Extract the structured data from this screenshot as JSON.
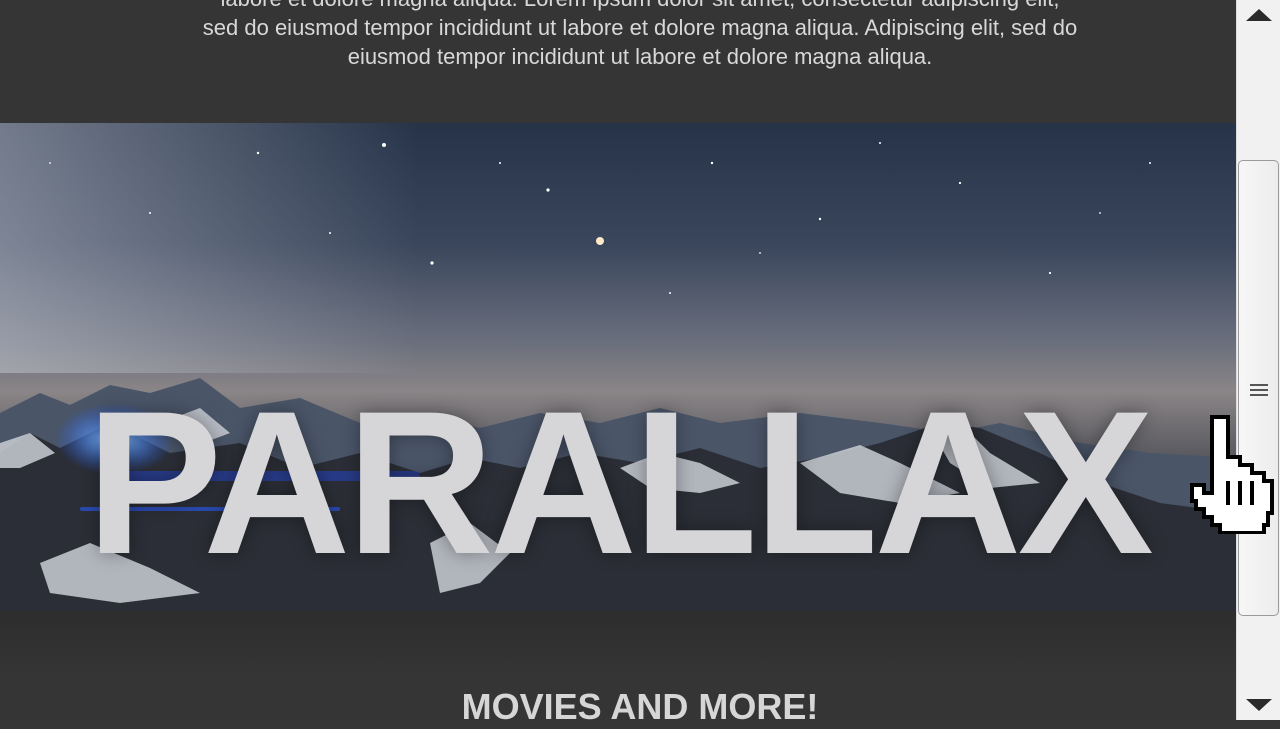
{
  "intro": {
    "lines": [
      "labore et dolore magna aliqua. Lorem ipsum dolor sit amet, consectetur adipiscing elit,",
      "sed do eiusmod tempor incididunt ut labore et dolore magna aliqua. Adipiscing elit, sed do",
      "eiusmod tempor incididunt ut labore et dolore magna aliqua."
    ]
  },
  "hero": {
    "title": "PARALLAX"
  },
  "section": {
    "heading": "MOVIES AND MORE!"
  },
  "scrollbar": {
    "up_icon": "triangle-up-icon",
    "down_icon": "triangle-down-icon",
    "grip_icon": "grip-lines-icon"
  },
  "cursor": {
    "icon": "hand-pointer-cursor"
  },
  "colors": {
    "page_bg": "#353535",
    "text": "#d8d8d8",
    "scrollbar_bg": "#f1f1f1"
  }
}
